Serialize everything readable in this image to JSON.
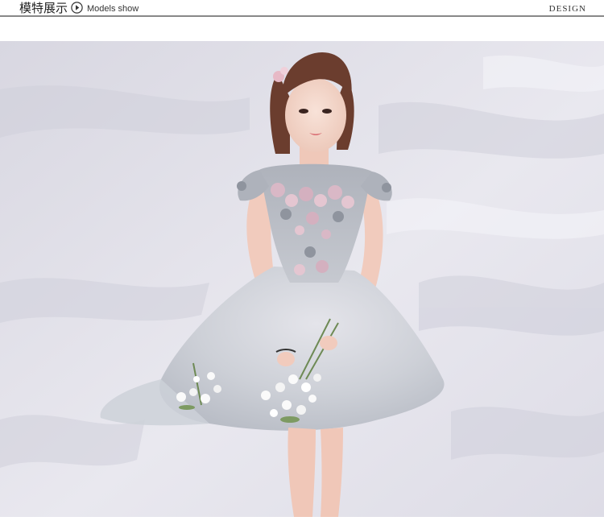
{
  "header": {
    "title_cn": "模特展示",
    "title_en": "Models show",
    "right_label": "DESIGN",
    "icon": "play-circle-icon"
  },
  "photo": {
    "subject": "model-photo"
  },
  "colors": {
    "rule": "#888888",
    "wall": "#e9e7ee",
    "dress": "#c9ccd3",
    "flowers": "#d9b8c6",
    "hair": "#6b3d2e",
    "skin": "#f3d2c6"
  }
}
